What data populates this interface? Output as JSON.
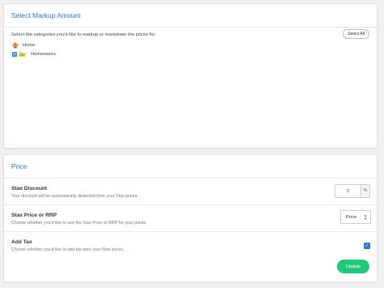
{
  "markup": {
    "title": "Select Markup Amount",
    "instructions": "Select the categories you'd like to markup or markdown the prices for.",
    "select_all_label": "Select All",
    "tree": {
      "root": {
        "label": "Home",
        "icon": "house-icon"
      },
      "children": [
        {
          "label": "Homewares",
          "icon": "folder-icon",
          "toggle": "+"
        }
      ]
    }
  },
  "price": {
    "title": "Price",
    "discount": {
      "title": "Stax Discount",
      "description": "Your discount will be automatically deducted from your Stax prices.",
      "value": "0",
      "unit": "%"
    },
    "source": {
      "title": "Stax Price or RRP",
      "description": "Choose whether you'd like to use the Stax Price or RRP for your prices.",
      "selected": "Price"
    },
    "tax": {
      "title": "Add Tax",
      "description": "Choose whether you'd like to add tax onto your Stax prices.",
      "checked": true
    },
    "update_label": "Update"
  },
  "colors": {
    "accent": "#2b78d8",
    "update_button": "#22c77a",
    "background": "#eef0f3"
  }
}
